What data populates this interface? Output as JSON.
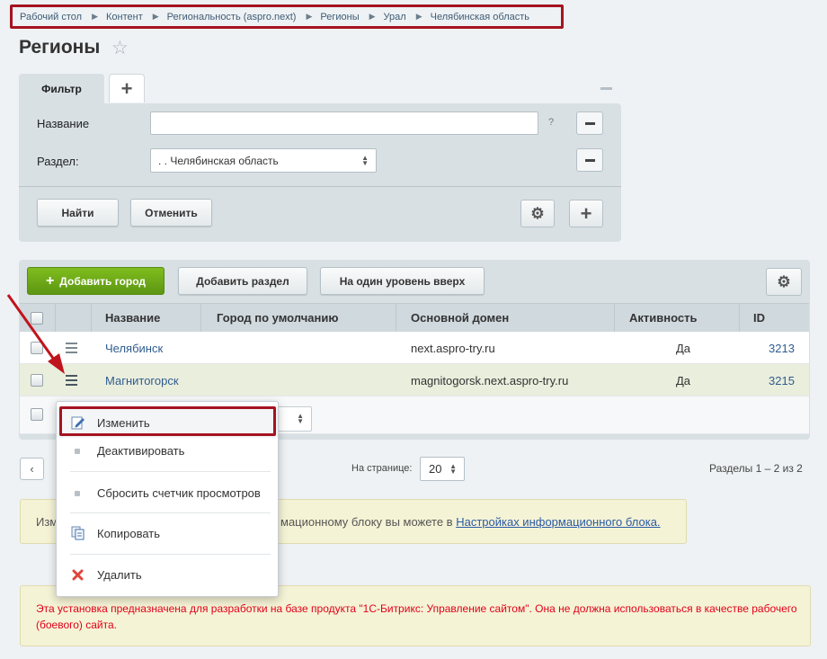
{
  "breadcrumb": [
    "Рабочий стол",
    "Контент",
    "Региональность (aspro.next)",
    "Регионы",
    "Урал",
    "Челябинская область"
  ],
  "page_title": "Регионы",
  "filter": {
    "tab_label": "Фильтр",
    "name_label": "Название",
    "name_value": "",
    "help_mark": "?",
    "section_label": "Раздел:",
    "section_value": ". . Челябинская область",
    "find_button": "Найти",
    "cancel_button": "Отменить"
  },
  "toolbar": {
    "add_city": "Добавить город",
    "add_section": "Добавить раздел",
    "level_up": "На один уровень вверх"
  },
  "table": {
    "columns": [
      "Название",
      "Город по умолчанию",
      "Основной домен",
      "Активность",
      "ID"
    ],
    "rows": [
      {
        "name": "Челябинск",
        "default_city": "",
        "domain": "next.aspro-try.ru",
        "active": "Да",
        "id": "3213"
      },
      {
        "name": "Магнитогорск",
        "default_city": "",
        "domain": "magnitogorsk.next.aspro-try.ru",
        "active": "Да",
        "id": "3215"
      }
    ]
  },
  "context_menu": {
    "items": [
      "Изменить",
      "Деактивировать",
      "Сбросить счетчик просмотров",
      "Копировать",
      "Удалить"
    ]
  },
  "pager": {
    "per_page_label": "На странице:",
    "per_page_value": "20",
    "count_text": "Разделы 1 – 2 из 2"
  },
  "info": {
    "text_start": "Изм",
    "text_mid": "мационному блоку вы можете в ",
    "link": "Настройках информационного блока."
  },
  "warning": "Эта установка предназначена для разработки на базе продукта \"1С-Битрикс: Управление сайтом\". Она не должна использоваться в качестве рабочего (боевого) сайта.",
  "colors": {
    "highlight": "#a51320",
    "accent_green": "#6ea817",
    "link": "#2f5c8e",
    "warning_text": "#e1001a"
  }
}
